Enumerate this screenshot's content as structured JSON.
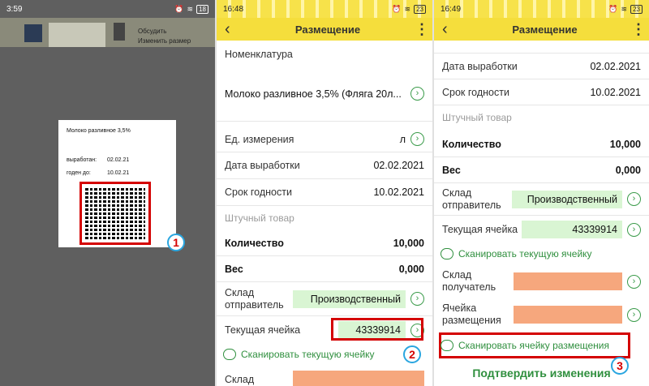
{
  "panel1": {
    "time": "3:59",
    "battery": "18",
    "camera_text": [
      "Обсудить",
      "Изменить размер"
    ],
    "card": {
      "product": "Молоко разливное 3,5%",
      "produced_label": "выработан:",
      "produced": "02.02.21",
      "expires_label": "годен до:",
      "expires": "10.02.21"
    },
    "badge": "1"
  },
  "panel2": {
    "time": "16:48",
    "battery": "23",
    "title": "Размещение",
    "nomenclature_label": "Номенклатура",
    "nomenclature_value": "Молоко разливное 3,5% (Фляга 20л...",
    "unit_label": "Ед. измерения",
    "unit_value": "л",
    "produced_label": "Дата выработки",
    "produced_value": "02.02.2021",
    "expiry_label": "Срок годности",
    "expiry_value": "10.02.2021",
    "piece_label": "Штучный товар",
    "qty_label": "Количество",
    "qty_value": "10,000",
    "weight_label": "Вес",
    "weight_value": "0,000",
    "sender_label": "Склад отправитель",
    "sender_value": "Производственный",
    "cell_label": "Текущая ячейка",
    "cell_value": "43339914",
    "scan_link": "Сканировать текущую ячейку",
    "bottom_label": "Склад",
    "badge": "2"
  },
  "panel3": {
    "time": "16:49",
    "battery": "23",
    "title": "Размещение",
    "produced_label": "Дата выработки",
    "produced_value": "02.02.2021",
    "expiry_label": "Срок годности",
    "expiry_value": "10.02.2021",
    "piece_label": "Штучный товар",
    "qty_label": "Количество",
    "qty_value": "10,000",
    "weight_label": "Вес",
    "weight_value": "0,000",
    "sender_label": "Склад отправитель",
    "sender_value": "Производственный",
    "cell_label": "Текущая ячейка",
    "cell_value": "43339914",
    "scan_current": "Сканировать текущую ячейку",
    "receiver_label": "Склад получатель",
    "place_cell_label": "Ячейка размещения",
    "scan_place": "Сканировать ячейку размещения",
    "confirm": "Подтвердить изменения",
    "badge": "3"
  },
  "colors": {
    "appbar": "#f5de3c",
    "accent": "#2f8f3e",
    "highlight": "#d40000",
    "field": "#d9f5d3",
    "empty_field": "#f6a77d"
  }
}
